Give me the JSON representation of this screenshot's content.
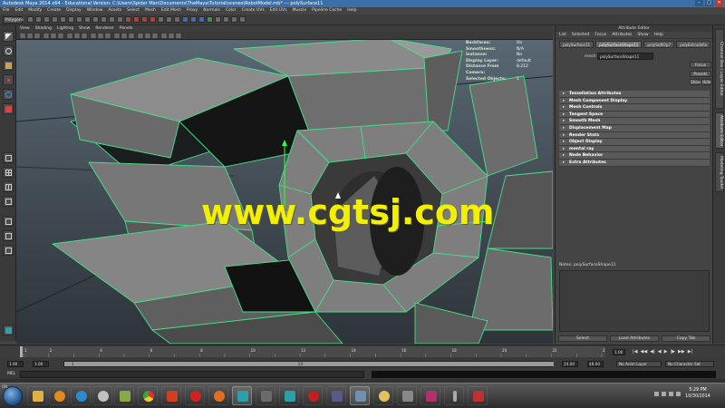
{
  "window": {
    "title": "Autodesk Maya 2014 x64 - Educational Version: C:\\Users\\Spider Man\\Documents\\TheMaya\\Tutorial\\scenes\\RobotModel.mb* --- polySurface11"
  },
  "menubar": [
    "File",
    "Edit",
    "Modify",
    "Create",
    "Display",
    "Window",
    "Assets",
    "Select",
    "Mesh",
    "Edit Mesh",
    "Proxy",
    "Normals",
    "Color",
    "Create UVs",
    "Edit UVs",
    "Muscle",
    "Pipeline Cache",
    "Help"
  ],
  "mode_select": "Polygons",
  "viewport": {
    "menu": [
      "View",
      "Shading",
      "Lighting",
      "Show",
      "Renderer",
      "Panels"
    ],
    "hud": [
      {
        "label": "Backfaces:",
        "value": "On"
      },
      {
        "label": "Smoothness:",
        "value": "N/A"
      },
      {
        "label": "Instance:",
        "value": "No"
      },
      {
        "label": "Display Layer:",
        "value": "default"
      },
      {
        "label": "Distance From Camera:",
        "value": "8.212"
      },
      {
        "label": "Selected Objects:",
        "value": "1"
      }
    ],
    "watermark": "www.cgtsj.com"
  },
  "attribute_editor": {
    "title": "Attribute Editor",
    "menu": [
      "List",
      "Selected",
      "Focus",
      "Attributes",
      "Show",
      "Help"
    ],
    "tabs": [
      "polySurface11",
      "polySurfaceShape11",
      "polySoftOp7",
      "polyExtrudeFa"
    ],
    "active_tab": 1,
    "mesh_label": "mesh:",
    "mesh_value": "polySurfaceShape11",
    "side_buttons": [
      "Focus",
      "Presets",
      "Show",
      "Hide"
    ],
    "sections": [
      "Tessellation Attributes",
      "Mesh Component Display",
      "Mesh Controls",
      "Tangent Space",
      "Smooth Mesh",
      "Displacement Map",
      "Render Stats",
      "Object Display",
      "mental ray",
      "Node Behavior",
      "Extra Attributes"
    ],
    "notes_label": "Notes: polySurfaceShape11",
    "buttons": [
      "Select",
      "Load Attributes",
      "Copy Tab"
    ]
  },
  "vertical_tabs": [
    "Channel Box / Layer Editor",
    "Attribute Editor",
    "Modeling Toolkit"
  ],
  "timeslider": {
    "ticks": [
      "1",
      "2",
      "4",
      "6",
      "8",
      "10",
      "12",
      "14",
      "16",
      "18",
      "20",
      "22",
      "24"
    ],
    "current_time": "1.00",
    "playback_icons": [
      "|◀",
      "◀◀",
      "◀|",
      "◀",
      "▶",
      "|▶",
      "▶▶",
      "▶|"
    ]
  },
  "rangeslider": {
    "start": "1.00",
    "inner_start": "1.00",
    "bar_left": "1",
    "bar_right": "24",
    "end_inner": "24.00",
    "end": "48.00",
    "anim_layer": "No Anim Layer",
    "char_set": "No Character Set"
  },
  "cmdline": {
    "label": "MEL"
  },
  "taskbar": {
    "time": "5:29 PM",
    "date": "10/30/2014",
    "chip": "ON"
  },
  "colors": {
    "wire": "#46e08a",
    "watermark": "#f2f000",
    "titlebar": "#3a6fa8"
  }
}
